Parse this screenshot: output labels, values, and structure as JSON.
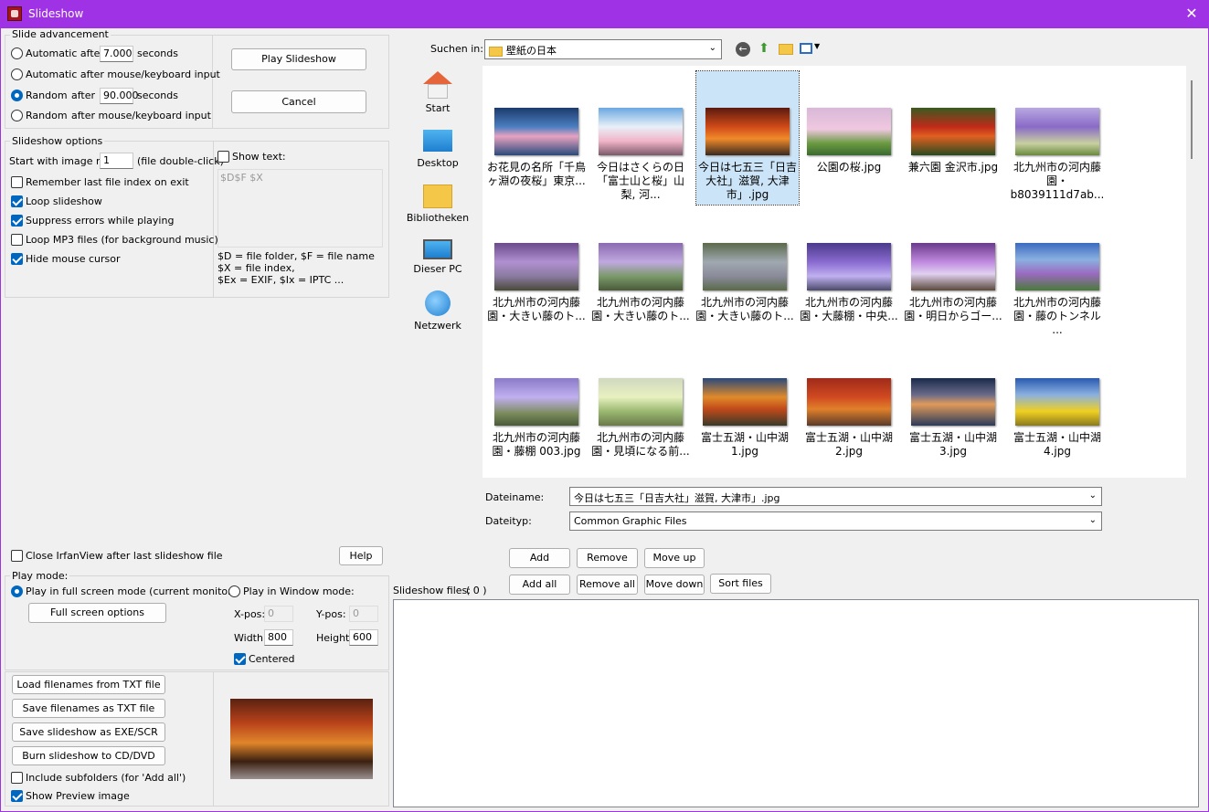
{
  "window": {
    "title": "Slideshow",
    "close": "✕"
  },
  "advance": {
    "group": "Slide advancement",
    "auto_label": "Automatic after",
    "auto_value": "7.000",
    "seconds1": "seconds",
    "auto_input_label": "Automatic after mouse/keyboard input",
    "random_label": "Random",
    "random_after": "after",
    "random_value": "90.000",
    "seconds2": "seconds",
    "random_input_label": "Random",
    "random_input_after": "after mouse/keyboard input",
    "play_btn": "Play Slideshow",
    "cancel_btn": "Cancel"
  },
  "options": {
    "group": "Slideshow options",
    "start_label": "Start with image nr.:",
    "start_value": "1",
    "start_hint": "(file double-click)",
    "remember": "Remember last file index on exit",
    "loop": "Loop slideshow",
    "suppress": "Suppress errors while playing",
    "loop_mp3": "Loop MP3 files (for background music)",
    "hide_cursor": "Hide mouse cursor",
    "show_text": "Show text:",
    "text_value": "$D$F $X",
    "help1": "$D = file folder, $F = file name",
    "help2": "$X = file index,",
    "help3": "$Ex = EXIF, $Ix = IPTC ..."
  },
  "close_after": "Close IrfanView after last slideshow file",
  "help_btn": "Help",
  "playmode": {
    "group": "Play mode:",
    "fullscreen": "Play in full screen mode (current monitor)",
    "fs_options": "Full screen options",
    "window": "Play in Window mode:",
    "xpos_label": "X-pos:",
    "xpos": "0",
    "ypos_label": "Y-pos:",
    "ypos": "0",
    "width_label": "Width:",
    "width": "800",
    "height_label": "Height:",
    "height": "600",
    "centered": "Centered"
  },
  "bottom": {
    "load": "Load filenames from TXT file",
    "save": "Save filenames as TXT file",
    "save_exe": "Save slideshow as  EXE/SCR",
    "burn": "Burn slideshow to CD/DVD",
    "subfolders": "Include subfolders (for 'Add all')",
    "preview": "Show Preview image"
  },
  "browser": {
    "lookin_label": "Suchen in:",
    "lookin_value": "壁紙の日本",
    "places": [
      {
        "label": "Start",
        "icon": "home-icon"
      },
      {
        "label": "Desktop",
        "icon": "desktop-icon"
      },
      {
        "label": "Bibliotheken",
        "icon": "libraries-icon"
      },
      {
        "label": "Dieser PC",
        "icon": "pc-icon"
      },
      {
        "label": "Netzwerk",
        "icon": "network-icon"
      }
    ],
    "files": [
      "お花見の名所「千鳥ヶ淵の夜桜」東京...",
      "今日はさくらの日「富士山と桜」山梨, 河...",
      "今日は七五三「日吉大社」滋賀, 大津市」.jpg",
      "公園の桜.jpg",
      "兼六園  金沢市.jpg",
      "北九州市の河内藤園・b8039111d7ab...",
      "北九州市の河内藤園・大きい藤のト...",
      "北九州市の河内藤園・大きい藤のト...",
      "北九州市の河内藤園・大きい藤のト...",
      "北九州市の河内藤園・大藤棚・中央...",
      "北九州市の河内藤園・明日からゴー...",
      "北九州市の河内藤園・藤のトンネル ...",
      "北九州市の河内藤園・藤棚 003.jpg",
      "北九州市の河内藤園・見頃になる前...",
      "富士五湖・山中湖1.jpg",
      "富士五湖・山中湖2.jpg",
      "富士五湖・山中湖3.jpg",
      "富士五湖・山中湖4.jpg"
    ],
    "filename_label": "Dateiname:",
    "filename_value": "今日は七五三「日吉大社」滋賀, 大津市」.jpg",
    "filetype_label": "Dateityp:",
    "filetype_value": "Common Graphic Files"
  },
  "list": {
    "add": "Add",
    "remove": "Remove",
    "move_up": "Move up",
    "add_all": "Add all",
    "remove_all": "Remove all",
    "move_down": "Move down",
    "sort": "Sort files",
    "label": "Slideshow files:",
    "count": "( 0 )"
  }
}
